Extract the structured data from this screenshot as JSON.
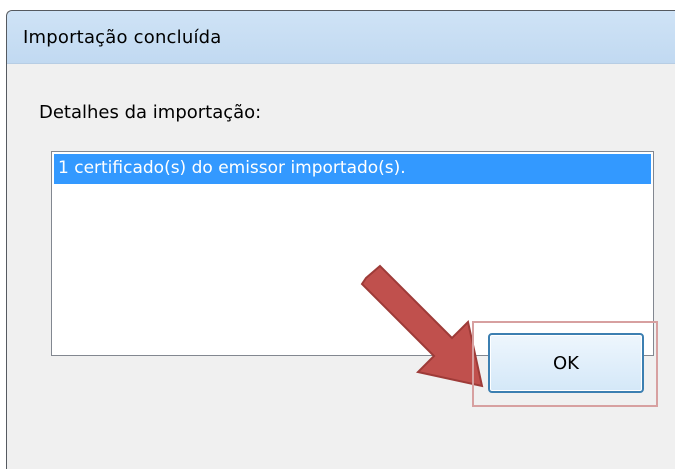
{
  "window": {
    "title": "Importação concluída"
  },
  "dialog": {
    "details_label": "Detalhes da importação:",
    "list_items": [
      "1 certificado(s) do emissor importado(s)."
    ],
    "ok_label": "OK"
  },
  "colors": {
    "titlebar": "#c6dcf2",
    "selection": "#3399ff",
    "arrow": "#c0504d",
    "highlight_border": "#d7a0a0"
  }
}
